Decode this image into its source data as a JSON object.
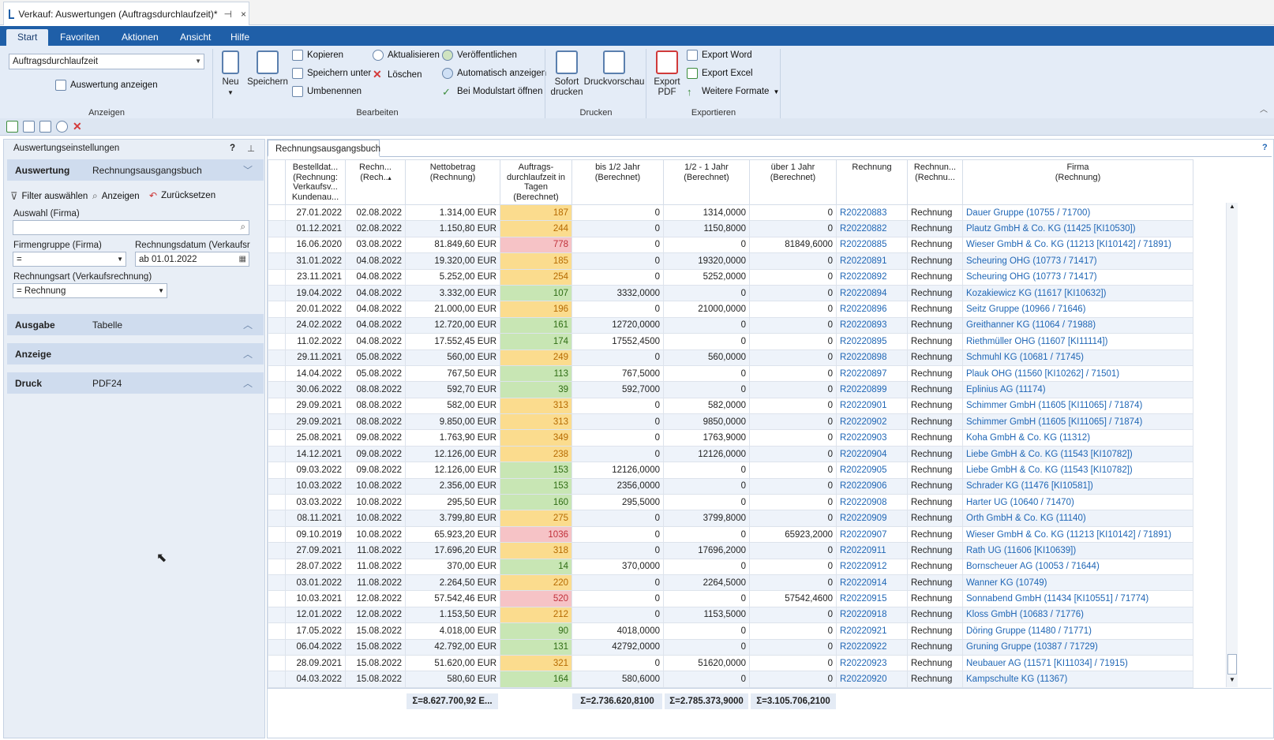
{
  "window": {
    "title": "Verkauf: Auswertungen (Auftragsdurchlaufzeit)*",
    "pin": "⊣",
    "close": "×"
  },
  "menu": [
    "Start",
    "Favoriten",
    "Aktionen",
    "Ansicht",
    "Hilfe"
  ],
  "ribbon": {
    "report_combo": "Auftragsdurchlaufzeit",
    "show_report": "Auswertung anzeigen",
    "group_anzeigen": "Anzeigen",
    "neu": "Neu",
    "speichern": "Speichern",
    "kopieren": "Kopieren",
    "speichern_unter": "Speichern unter",
    "umbenennen": "Umbenennen",
    "aktualisieren": "Aktualisieren",
    "loeschen": "Löschen",
    "veroeffentlichen": "Veröffentlichen",
    "auto_anzeigen": "Automatisch anzeigen",
    "modulstart": "Bei Modulstart öffnen",
    "group_bearbeiten": "Bearbeiten",
    "sofort_l1": "Sofort",
    "sofort_l2": "drucken",
    "druckvorschau": "Druckvorschau",
    "group_drucken": "Drucken",
    "export_pdf_l1": "Export",
    "export_pdf_l2": "PDF",
    "export_word": "Export Word",
    "export_excel": "Export Excel",
    "weitere": "Weitere Formate",
    "group_exportieren": "Exportieren"
  },
  "left": {
    "header": "Auswertungseinstellungen",
    "help": "?",
    "auswertung_label": "Auswertung",
    "auswertung_value": "Rechnungsausgangsbuch",
    "filter": "Filter auswählen",
    "anzeigen": "Anzeigen",
    "zuruecksetzen": "Zurücksetzen",
    "auswahl_firma": "Auswahl (Firma)",
    "firmengruppe": "Firmengruppe (Firma)",
    "rechnungsdatum": "Rechnungsdatum (Verkaufsrec",
    "firmengruppe_op": "=",
    "rechnungsdatum_val": "ab  01.01.2022",
    "rechnungsart": "Rechnungsart (Verkaufsrechnung)",
    "rechnungsart_val": "=   Rechnung",
    "ausgabe_label": "Ausgabe",
    "ausgabe_value": "Tabelle",
    "anzeige_label": "Anzeige",
    "druck_label": "Druck",
    "druck_value": "PDF24"
  },
  "grid": {
    "tab": "Rechnungsausgangsbuch",
    "help": "?",
    "headers": [
      [
        "Bestelldat...",
        "(Rechnung:",
        "Verkaufsv...",
        "Kundenau..."
      ],
      [
        "Rechn...",
        "(Rech..."
      ],
      [
        "Nettobetrag",
        "(Rechnung)"
      ],
      [
        "Auftrags-",
        "durchlaufzeit in",
        "Tagen",
        "(Berechnet)"
      ],
      [
        "bis 1/2 Jahr",
        "(Berechnet)"
      ],
      [
        "1/2 - 1 Jahr",
        "(Berechnet)"
      ],
      [
        "über 1 Jahr",
        "(Berechnet)"
      ],
      [
        "Rechnung"
      ],
      [
        "Rechnun...",
        "(Rechnu..."
      ],
      [
        "Firma",
        "(Rechnung)"
      ]
    ],
    "rows": [
      [
        "27.01.2022",
        "02.08.2022",
        "1.314,00 EUR",
        "187",
        "0",
        "1314,0000",
        "0",
        "R20220883",
        "Rechnung",
        "Dauer Gruppe (10755 / 71700)"
      ],
      [
        "01.12.2021",
        "02.08.2022",
        "1.150,80 EUR",
        "244",
        "0",
        "1150,8000",
        "0",
        "R20220882",
        "Rechnung",
        "Plautz GmbH & Co. KG (11425 [KI10530])"
      ],
      [
        "16.06.2020",
        "03.08.2022",
        "81.849,60 EUR",
        "778",
        "0",
        "0",
        "81849,6000",
        "R20220885",
        "Rechnung",
        "Wieser GmbH & Co. KG (11213 [KI10142] / 71891)"
      ],
      [
        "31.01.2022",
        "04.08.2022",
        "19.320,00 EUR",
        "185",
        "0",
        "19320,0000",
        "0",
        "R20220891",
        "Rechnung",
        "Scheuring OHG (10773 / 71417)"
      ],
      [
        "23.11.2021",
        "04.08.2022",
        "5.252,00 EUR",
        "254",
        "0",
        "5252,0000",
        "0",
        "R20220892",
        "Rechnung",
        "Scheuring OHG (10773 / 71417)"
      ],
      [
        "19.04.2022",
        "04.08.2022",
        "3.332,00 EUR",
        "107",
        "3332,0000",
        "0",
        "0",
        "R20220894",
        "Rechnung",
        "Kozakiewicz KG (11617 [KI10632])"
      ],
      [
        "20.01.2022",
        "04.08.2022",
        "21.000,00 EUR",
        "196",
        "0",
        "21000,0000",
        "0",
        "R20220896",
        "Rechnung",
        "Seitz Gruppe (10966 / 71646)"
      ],
      [
        "24.02.2022",
        "04.08.2022",
        "12.720,00 EUR",
        "161",
        "12720,0000",
        "0",
        "0",
        "R20220893",
        "Rechnung",
        "Greithanner KG (11064 / 71988)"
      ],
      [
        "11.02.2022",
        "04.08.2022",
        "17.552,45 EUR",
        "174",
        "17552,4500",
        "0",
        "0",
        "R20220895",
        "Rechnung",
        "Riethmüller OHG (11607 [KI11114])"
      ],
      [
        "29.11.2021",
        "05.08.2022",
        "560,00 EUR",
        "249",
        "0",
        "560,0000",
        "0",
        "R20220898",
        "Rechnung",
        "Schmuhl KG (10681 / 71745)"
      ],
      [
        "14.04.2022",
        "05.08.2022",
        "767,50 EUR",
        "113",
        "767,5000",
        "0",
        "0",
        "R20220897",
        "Rechnung",
        "Plauk OHG (11560 [KI10262] / 71501)"
      ],
      [
        "30.06.2022",
        "08.08.2022",
        "592,70 EUR",
        "39",
        "592,7000",
        "0",
        "0",
        "R20220899",
        "Rechnung",
        "Eplinius AG (11174)"
      ],
      [
        "29.09.2021",
        "08.08.2022",
        "582,00 EUR",
        "313",
        "0",
        "582,0000",
        "0",
        "R20220901",
        "Rechnung",
        "Schimmer GmbH (11605 [KI11065] / 71874)"
      ],
      [
        "29.09.2021",
        "08.08.2022",
        "9.850,00 EUR",
        "313",
        "0",
        "9850,0000",
        "0",
        "R20220902",
        "Rechnung",
        "Schimmer GmbH (11605 [KI11065] / 71874)"
      ],
      [
        "25.08.2021",
        "09.08.2022",
        "1.763,90 EUR",
        "349",
        "0",
        "1763,9000",
        "0",
        "R20220903",
        "Rechnung",
        "Koha GmbH & Co. KG (11312)"
      ],
      [
        "14.12.2021",
        "09.08.2022",
        "12.126,00 EUR",
        "238",
        "0",
        "12126,0000",
        "0",
        "R20220904",
        "Rechnung",
        "Liebe GmbH & Co. KG (11543 [KI10782])"
      ],
      [
        "09.03.2022",
        "09.08.2022",
        "12.126,00 EUR",
        "153",
        "12126,0000",
        "0",
        "0",
        "R20220905",
        "Rechnung",
        "Liebe GmbH & Co. KG (11543 [KI10782])"
      ],
      [
        "10.03.2022",
        "10.08.2022",
        "2.356,00 EUR",
        "153",
        "2356,0000",
        "0",
        "0",
        "R20220906",
        "Rechnung",
        "Schrader KG (11476 [KI10581])"
      ],
      [
        "03.03.2022",
        "10.08.2022",
        "295,50 EUR",
        "160",
        "295,5000",
        "0",
        "0",
        "R20220908",
        "Rechnung",
        "Harter UG (10640 / 71470)"
      ],
      [
        "08.11.2021",
        "10.08.2022",
        "3.799,80 EUR",
        "275",
        "0",
        "3799,8000",
        "0",
        "R20220909",
        "Rechnung",
        "Orth GmbH & Co. KG (11140)"
      ],
      [
        "09.10.2019",
        "10.08.2022",
        "65.923,20 EUR",
        "1036",
        "0",
        "0",
        "65923,2000",
        "R20220907",
        "Rechnung",
        "Wieser GmbH & Co. KG (11213 [KI10142] / 71891)"
      ],
      [
        "27.09.2021",
        "11.08.2022",
        "17.696,20 EUR",
        "318",
        "0",
        "17696,2000",
        "0",
        "R20220911",
        "Rechnung",
        "Rath UG (11606 [KI10639])"
      ],
      [
        "28.07.2022",
        "11.08.2022",
        "370,00 EUR",
        "14",
        "370,0000",
        "0",
        "0",
        "R20220912",
        "Rechnung",
        "Bornscheuer AG (10053 / 71644)"
      ],
      [
        "03.01.2022",
        "11.08.2022",
        "2.264,50 EUR",
        "220",
        "0",
        "2264,5000",
        "0",
        "R20220914",
        "Rechnung",
        "Wanner KG (10749)"
      ],
      [
        "10.03.2021",
        "12.08.2022",
        "57.542,46 EUR",
        "520",
        "0",
        "0",
        "57542,4600",
        "R20220915",
        "Rechnung",
        "Sonnabend GmbH (11434 [KI10551] / 71774)"
      ],
      [
        "12.01.2022",
        "12.08.2022",
        "1.153,50 EUR",
        "212",
        "0",
        "1153,5000",
        "0",
        "R20220918",
        "Rechnung",
        "Kloss GmbH (10683 / 71776)"
      ],
      [
        "17.05.2022",
        "15.08.2022",
        "4.018,00 EUR",
        "90",
        "4018,0000",
        "0",
        "0",
        "R20220921",
        "Rechnung",
        "Döring Gruppe (11480 / 71771)"
      ],
      [
        "06.04.2022",
        "15.08.2022",
        "42.792,00 EUR",
        "131",
        "42792,0000",
        "0",
        "0",
        "R20220922",
        "Rechnung",
        "Gruning Gruppe (10387 / 71729)"
      ],
      [
        "28.09.2021",
        "15.08.2022",
        "51.620,00 EUR",
        "321",
        "0",
        "51620,0000",
        "0",
        "R20220923",
        "Rechnung",
        "Neubauer AG (11571 [KI11034] / 71915)"
      ],
      [
        "04.03.2022",
        "15.08.2022",
        "580,60 EUR",
        "164",
        "580,6000",
        "0",
        "0",
        "R20220920",
        "Rechnung",
        "Kampschulte KG (11367)"
      ]
    ],
    "sums": [
      "Σ=8.627.700,92 E...",
      "Σ=2.736.620,8100",
      "Σ=2.785.373,9000",
      "Σ=3.105.706,2100"
    ]
  },
  "colors": {
    "green": "#c8e6b4",
    "yellow": "#fbdc8e",
    "red": "#f6c3c6",
    "accent": "#1f5fa8"
  }
}
